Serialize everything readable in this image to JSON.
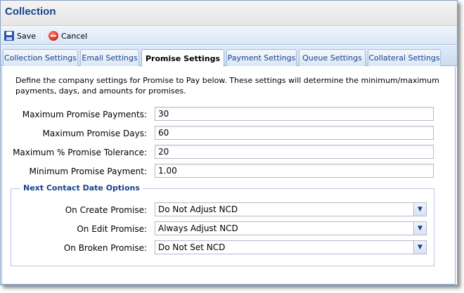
{
  "window": {
    "title": "Collection"
  },
  "toolbar": {
    "save_label": "Save",
    "cancel_label": "Cancel"
  },
  "tabs": [
    {
      "label": "Collection Settings",
      "active": false
    },
    {
      "label": "Email Settings",
      "active": false
    },
    {
      "label": "Promise Settings",
      "active": true
    },
    {
      "label": "Payment Settings",
      "active": false
    },
    {
      "label": "Queue Settings",
      "active": false
    },
    {
      "label": "Collateral Settings",
      "active": false
    }
  ],
  "promise": {
    "description": "Define the company settings for Promise to Pay below. These settings will determine the minimum/maximum payments, days, and amounts for promises.",
    "fields": [
      {
        "label": "Maximum Promise Payments:",
        "value": "30"
      },
      {
        "label": "Maximum Promise Days:",
        "value": "60"
      },
      {
        "label": "Maximum % Promise Tolerance:",
        "value": "20"
      },
      {
        "label": "Minimum Promise Payment:",
        "value": "1.00"
      }
    ],
    "ncd": {
      "legend": "Next Contact Date Options",
      "options": [
        {
          "label": "On Create Promise:",
          "value": "Do Not Adjust NCD"
        },
        {
          "label": "On Edit Promise:",
          "value": "Always Adjust NCD"
        },
        {
          "label": "On Broken Promise:",
          "value": "Do Not Set NCD"
        }
      ]
    }
  },
  "icons": {
    "save": "floppy-disk-icon",
    "cancel": "cancel-circle-icon",
    "combo_trigger": "chevron-down-icon"
  },
  "colors": {
    "title": "#15428b",
    "tab_border": "#8db2e3",
    "toolbar_bg": "#d9e6f5"
  }
}
